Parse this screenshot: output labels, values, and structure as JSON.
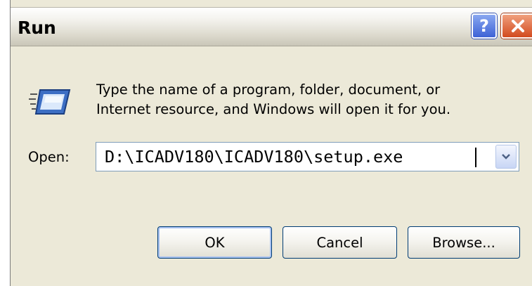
{
  "window": {
    "title": "Run",
    "help_glyph": "?"
  },
  "description": {
    "line1": "Type the name of a program, folder, document, or",
    "line2": "Internet resource, and Windows will open it for you."
  },
  "open": {
    "label": "Open:",
    "value": "D:\\ICADV180\\ICADV180\\setup.exe"
  },
  "buttons": {
    "ok": "OK",
    "cancel": "Cancel",
    "browse": "Browse..."
  },
  "icons": {
    "run": "run-icon",
    "help": "help-icon",
    "close": "close-icon",
    "dropdown": "chevron-down-icon"
  },
  "colors": {
    "dialog_background": "#ece9d8",
    "help_button": "#3d62d6",
    "close_button": "#d24a1e",
    "button_border": "#003c74"
  }
}
